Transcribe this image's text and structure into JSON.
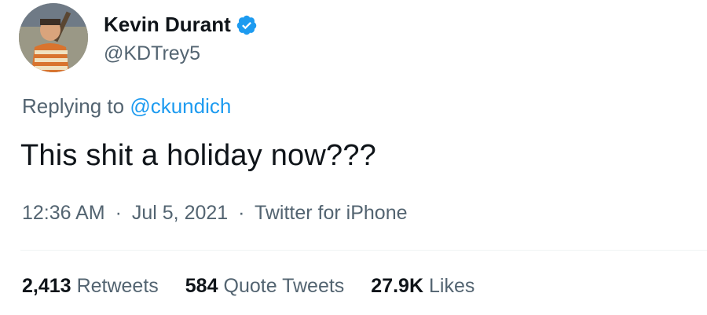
{
  "user": {
    "display_name": "Kevin Durant",
    "handle": "@KDTrey5",
    "verified": true,
    "avatar_icon": "avatar-photo"
  },
  "reply": {
    "prefix": "Replying to",
    "handle": "@ckundich"
  },
  "tweet": {
    "text": "This shit a holiday now???"
  },
  "meta": {
    "time": "12:36 AM",
    "date": "Jul 5, 2021",
    "source": "Twitter for iPhone",
    "separator": "·"
  },
  "stats": {
    "retweets_count": "2,413",
    "retweets_label": "Retweets",
    "quotes_count": "584",
    "quotes_label": "Quote Tweets",
    "likes_count": "27.9K",
    "likes_label": "Likes"
  },
  "colors": {
    "link": "#1d9bf0",
    "secondary_text": "#536471",
    "primary_text": "#0f1419",
    "divider": "#eff3f4"
  }
}
